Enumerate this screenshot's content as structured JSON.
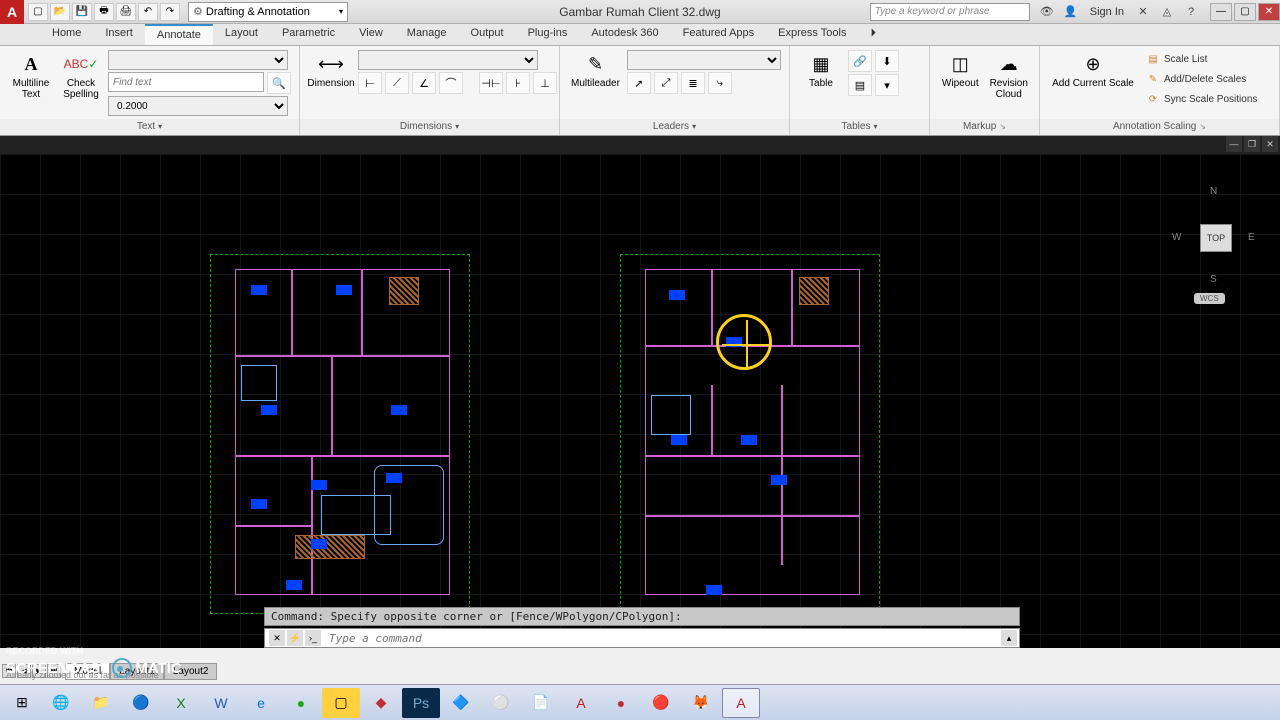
{
  "title": "Gambar Rumah Client 32.dwg",
  "workspace": "Drafting & Annotation",
  "search_placeholder": "Type a keyword or phrase",
  "signin": "Sign In",
  "tabs": [
    "Home",
    "Insert",
    "Annotate",
    "Layout",
    "Parametric",
    "View",
    "Manage",
    "Output",
    "Plug-ins",
    "Autodesk 360",
    "Featured Apps",
    "Express Tools"
  ],
  "active_tab": "Annotate",
  "panels": {
    "text": {
      "title": "Text",
      "multiline": "Multiline\nText",
      "check": "Check\nSpelling",
      "find_ph": "Find text",
      "height": "0.2000"
    },
    "dimensions": {
      "title": "Dimensions",
      "dim_label": "Dimension"
    },
    "leaders": {
      "title": "Leaders",
      "ml_label": "Multileader"
    },
    "tables": {
      "title": "Tables",
      "tbl_label": "Table"
    },
    "markup": {
      "title": "Markup",
      "wipeout": "Wipeout",
      "revcloud": "Revision\nCloud"
    },
    "anno": {
      "title": "Annotation Scaling",
      "add": "Add Current Scale",
      "list": "Scale List",
      "adddel": "Add/Delete Scales",
      "sync": "Sync Scale Positions"
    }
  },
  "viewcube": {
    "top": "TOP",
    "n": "N",
    "e": "E",
    "s": "S",
    "w": "W",
    "wcs": "WCS"
  },
  "cmd_hist": "Command: Specify opposite corner or [Fence/WPolygon/CPolygon]:",
  "cmd_placeholder": "Type a command",
  "layout_tabs": [
    "Model",
    "Layout1",
    "Layout2"
  ],
  "active_layout": "Model",
  "status_zoom": "Already zoomed out as far as possible",
  "watermark1": "RECORDED WITH",
  "watermark2": "SCREENCAST",
  "watermark3": "MATIC"
}
